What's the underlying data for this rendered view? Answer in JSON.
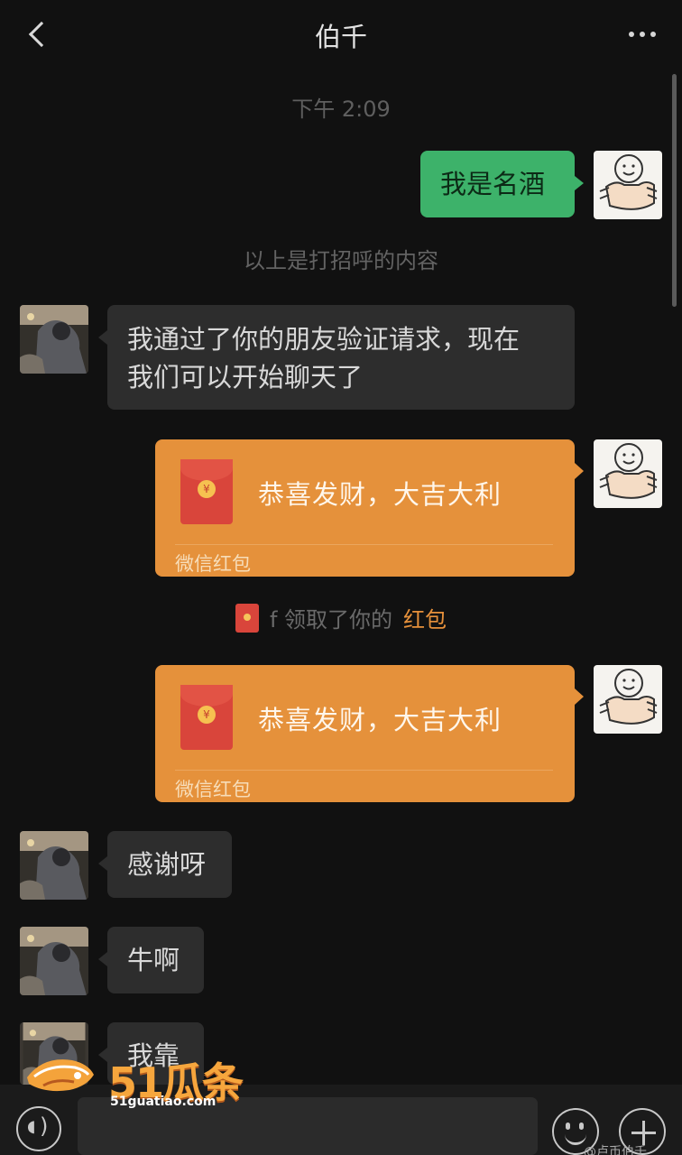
{
  "header": {
    "title": "伯千"
  },
  "chat": {
    "time": "下午 2:09",
    "my_message": "我是名酒",
    "system_note": "以上是打招呼的内容",
    "friend_message_1_line_1": "我通过了你的朋友验证请求，现在",
    "friend_message_1_line_2": "我们可以开始聊天了",
    "red_packet_1": {
      "message": "恭喜发财，大吉大利",
      "footer": "微信红包",
      "coin": "¥"
    },
    "notice_prefix": "f 领取了你的",
    "notice_link": "红包",
    "red_packet_2": {
      "message": "恭喜发财，大吉大利",
      "footer": "微信红包",
      "coin": "¥"
    },
    "friend_message_2": "感谢呀",
    "friend_message_3": "牛啊",
    "friend_message_4": "我靠"
  },
  "watermark": {
    "main": "51瓜条",
    "site": "51guatiao.com"
  },
  "corner_watermark": "@卢币伯千",
  "icons": {
    "back": "chevron-left-icon",
    "more": "more-icon",
    "voice": "voice-icon",
    "emoji": "emoji-icon",
    "plus": "plus-icon",
    "red_packet": "red-packet-icon"
  },
  "colors": {
    "background": "#111111",
    "green_bubble": "#3db26a",
    "gray_bubble": "#2d2d2d",
    "red_packet": "#e5913b",
    "red_packet_icon": "#d9453b"
  }
}
